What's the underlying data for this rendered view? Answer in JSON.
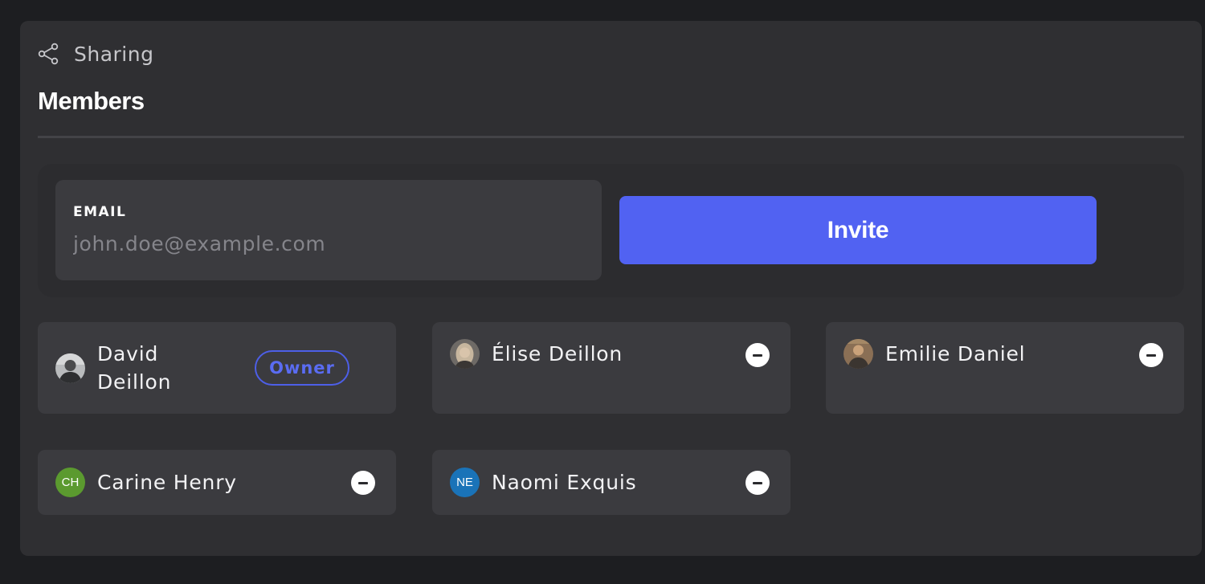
{
  "header": {
    "icon": "share-icon",
    "label": "Sharing"
  },
  "section": {
    "title": "Members"
  },
  "invite": {
    "email_label": "EMAIL",
    "email_placeholder": "john.doe@example.com",
    "email_value": "",
    "button_label": "Invite",
    "button_color": "#5162f2"
  },
  "members": [
    {
      "name": "David Deillon",
      "role": "Owner",
      "avatar": "photo",
      "removable": false
    },
    {
      "name": "Élise Deillon",
      "avatar": "photo",
      "removable": true
    },
    {
      "name": "Emilie Daniel",
      "avatar": "photo",
      "removable": true
    },
    {
      "name": "Carine Henry",
      "initials": "CH",
      "avatar_color": "#5b9a2f",
      "removable": true
    },
    {
      "name": "Naomi Exquis",
      "initials": "NE",
      "avatar_color": "#1a73b8",
      "removable": true
    }
  ],
  "remove_icon": "minus-circle-icon"
}
